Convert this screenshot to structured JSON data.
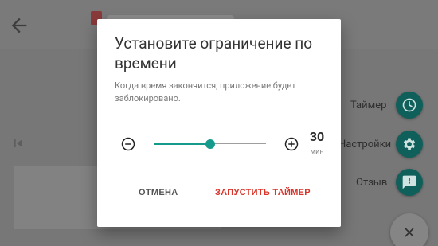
{
  "dialog": {
    "title": "Установите ограничение по времени",
    "message": "Когда время закончится, приложение будет заблокировано.",
    "slider": {
      "value": 30,
      "min": 0,
      "max": 60
    },
    "value_number": "30",
    "value_unit": "мин",
    "cancel_label": "ОТМЕНА",
    "start_label": "ЗАПУСТИТЬ ТАЙМЕР"
  },
  "fab_menu": {
    "items": [
      {
        "label": "Таймер",
        "icon": "clock-icon"
      },
      {
        "label": "Настройки",
        "icon": "gear-icon"
      },
      {
        "label": "Отзыв",
        "icon": "feedback-icon"
      }
    ],
    "close_icon": "close-icon"
  },
  "colors": {
    "accent": "#159a8c",
    "fab": "#0f5f5b",
    "danger_text": "#d8342a",
    "scrim": "#777777"
  }
}
